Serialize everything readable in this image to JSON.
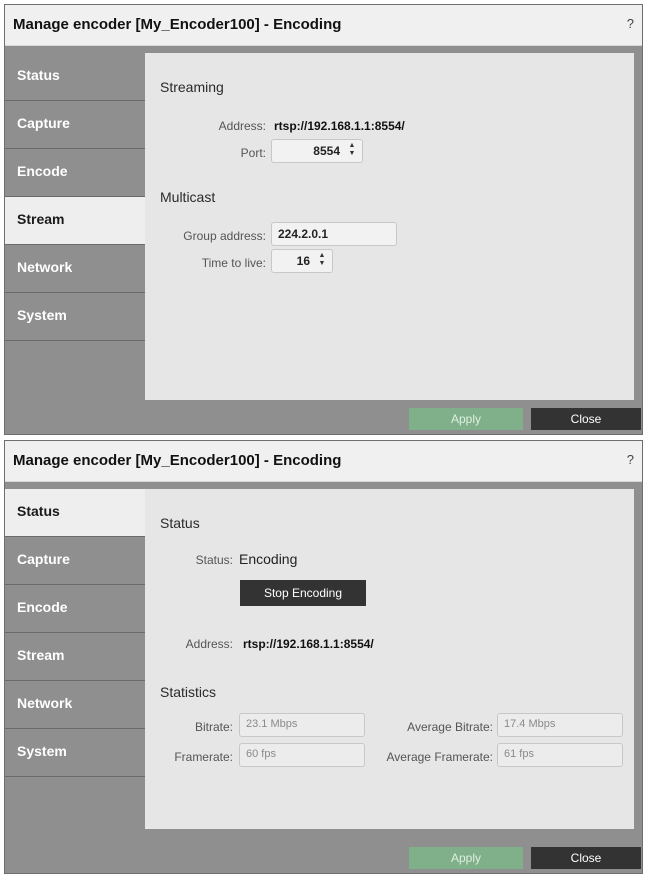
{
  "dialogs": [
    {
      "title": "Manage encoder [My_Encoder100] - Encoding",
      "help": "?",
      "tabs": [
        "Status",
        "Capture",
        "Encode",
        "Stream",
        "Network",
        "System"
      ],
      "active_tab": "Stream",
      "streaming": {
        "section_title": "Streaming",
        "address_label": "Address:",
        "address_value": "rtsp://192.168.1.1:8554/",
        "port_label": "Port:",
        "port_value": "8554"
      },
      "multicast": {
        "section_title": "Multicast",
        "group_label": "Group address:",
        "group_value": "224.2.0.1",
        "ttl_label": "Time to live:",
        "ttl_value": "16"
      },
      "footer": {
        "apply": "Apply",
        "close": "Close"
      }
    },
    {
      "title": "Manage encoder [My_Encoder100] - Encoding",
      "help": "?",
      "tabs": [
        "Status",
        "Capture",
        "Encode",
        "Stream",
        "Network",
        "System"
      ],
      "active_tab": "Status",
      "status": {
        "section_title": "Status",
        "status_label": "Status:",
        "status_value": "Encoding",
        "stop_button": "Stop Encoding",
        "address_label": "Address:",
        "address_value": "rtsp://192.168.1.1:8554/"
      },
      "statistics": {
        "section_title": "Statistics",
        "bitrate_label": "Bitrate:",
        "bitrate_value": "23.1 Mbps",
        "avg_bitrate_label": "Average Bitrate:",
        "avg_bitrate_value": "17.4 Mbps",
        "framerate_label": "Framerate:",
        "framerate_value": "60 fps",
        "avg_framerate_label": "Average Framerate:",
        "avg_framerate_value": "61 fps"
      },
      "footer": {
        "apply": "Apply",
        "close": "Close"
      }
    }
  ]
}
